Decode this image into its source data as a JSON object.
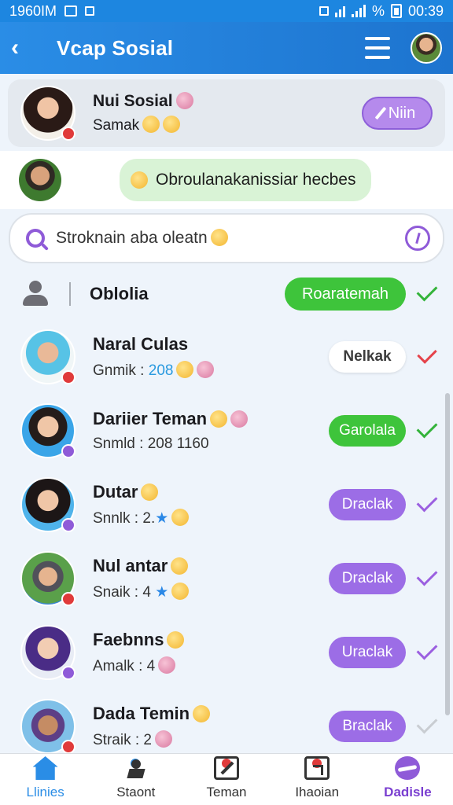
{
  "status_bar": {
    "left_text": "1960IM",
    "time": "00:39",
    "percent_icon": "%"
  },
  "app_bar": {
    "back_icon": "‹",
    "title": "Vcap Sosial"
  },
  "profile_card": {
    "name": "Nui Sosial",
    "subtitle": "Samak",
    "edit_label": "Niin"
  },
  "suggestion": {
    "text": "Obroulanakanissiar hecbes"
  },
  "search": {
    "placeholder": "Stroknain aba oleatn"
  },
  "list_header": {
    "label": "Oblolia",
    "action_label": "Roaratemah"
  },
  "rows": [
    {
      "name": "Naral Culas",
      "meta_label": "Gnmik",
      "meta_value": "208",
      "action": "Nelkak"
    },
    {
      "name": "Dariier Teman",
      "meta_label": "Snmld",
      "meta_value": "208 1160",
      "action": "Garolala"
    },
    {
      "name": "Dutar",
      "meta_label": "Snnlk",
      "meta_value": "2.",
      "action": "Draclak"
    },
    {
      "name": "Nul antar",
      "meta_label": "Snaik",
      "meta_value": "4",
      "action": "Draclak"
    },
    {
      "name": "Faebnns",
      "meta_label": "Amalk",
      "meta_value": "4",
      "action": "Uraclak"
    },
    {
      "name": "Dada Temin",
      "meta_label": "Straik",
      "meta_value": "2",
      "action": "Braclak"
    }
  ],
  "bottom_nav": [
    {
      "label": "Llinies",
      "icon": "home-icon"
    },
    {
      "label": "Staont",
      "icon": "activity-icon"
    },
    {
      "label": "Teman",
      "icon": "edit-icon"
    },
    {
      "label": "Ihaoian",
      "icon": "export-icon"
    },
    {
      "label": "Dadisle",
      "icon": "profile-icon"
    }
  ],
  "colors": {
    "primary": "#2a8de6",
    "accent_purple": "#9c6de6",
    "accent_green": "#3ec43b"
  }
}
